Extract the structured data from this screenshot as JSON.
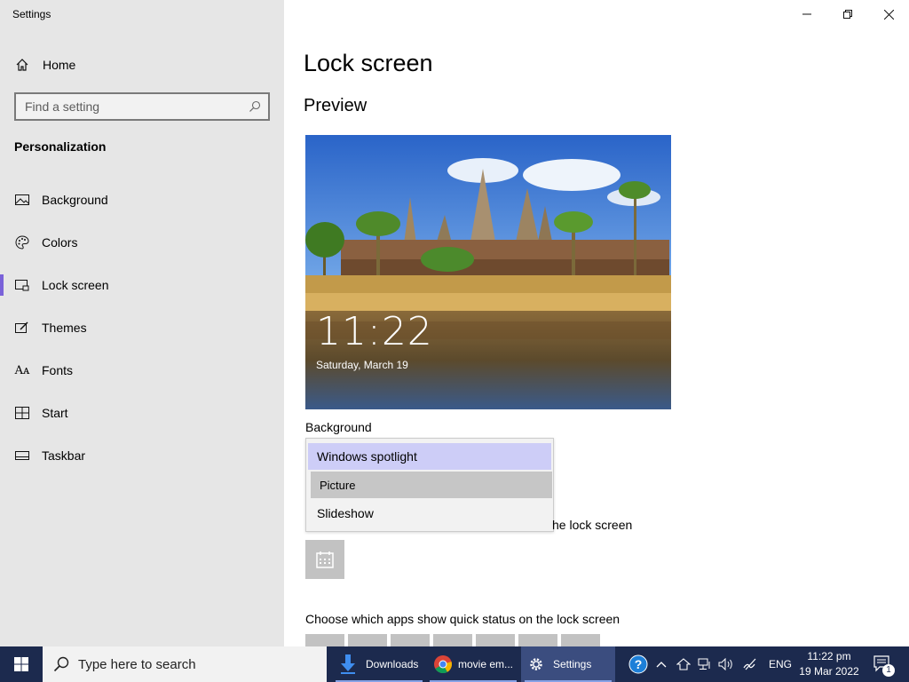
{
  "window": {
    "title": "Settings"
  },
  "sidebar": {
    "home_label": "Home",
    "search_placeholder": "Find a setting",
    "section_title": "Personalization",
    "items": [
      {
        "label": "Background",
        "icon": "picture-icon"
      },
      {
        "label": "Colors",
        "icon": "palette-icon"
      },
      {
        "label": "Lock screen",
        "icon": "lock-screen-icon",
        "active": true
      },
      {
        "label": "Themes",
        "icon": "brush-icon"
      },
      {
        "label": "Fonts",
        "icon": "font-icon"
      },
      {
        "label": "Start",
        "icon": "start-icon"
      },
      {
        "label": "Taskbar",
        "icon": "taskbar-icon"
      }
    ]
  },
  "main": {
    "title": "Lock screen",
    "preview_heading": "Preview",
    "preview_time": "11:22",
    "preview_date": "Saturday, March 19",
    "background_label": "Background",
    "dropdown_options": [
      "Windows spotlight",
      "Picture",
      "Slideshow"
    ],
    "selected_option": "Windows spotlight",
    "hovered_option": "Picture",
    "detailed_status_partial": "he lock screen",
    "quick_status_label": "Choose which apps show quick status on the lock screen"
  },
  "taskbar": {
    "search_placeholder": "Type here to search",
    "apps": [
      {
        "label": "Downloads",
        "icon": "folder-download-icon"
      },
      {
        "label": "movie em...",
        "icon": "chrome-icon"
      },
      {
        "label": "Settings",
        "icon": "gear-icon",
        "active": true
      }
    ],
    "language": "ENG",
    "time": "11:22 pm",
    "date": "19 Mar 2022",
    "notification_count": "1"
  },
  "colors": {
    "accent": "#7a62d9",
    "sidebar_bg": "#e6e6e6",
    "taskbar_bg": "#1c2a4e",
    "dropdown_selected": "#cdcdf7"
  }
}
